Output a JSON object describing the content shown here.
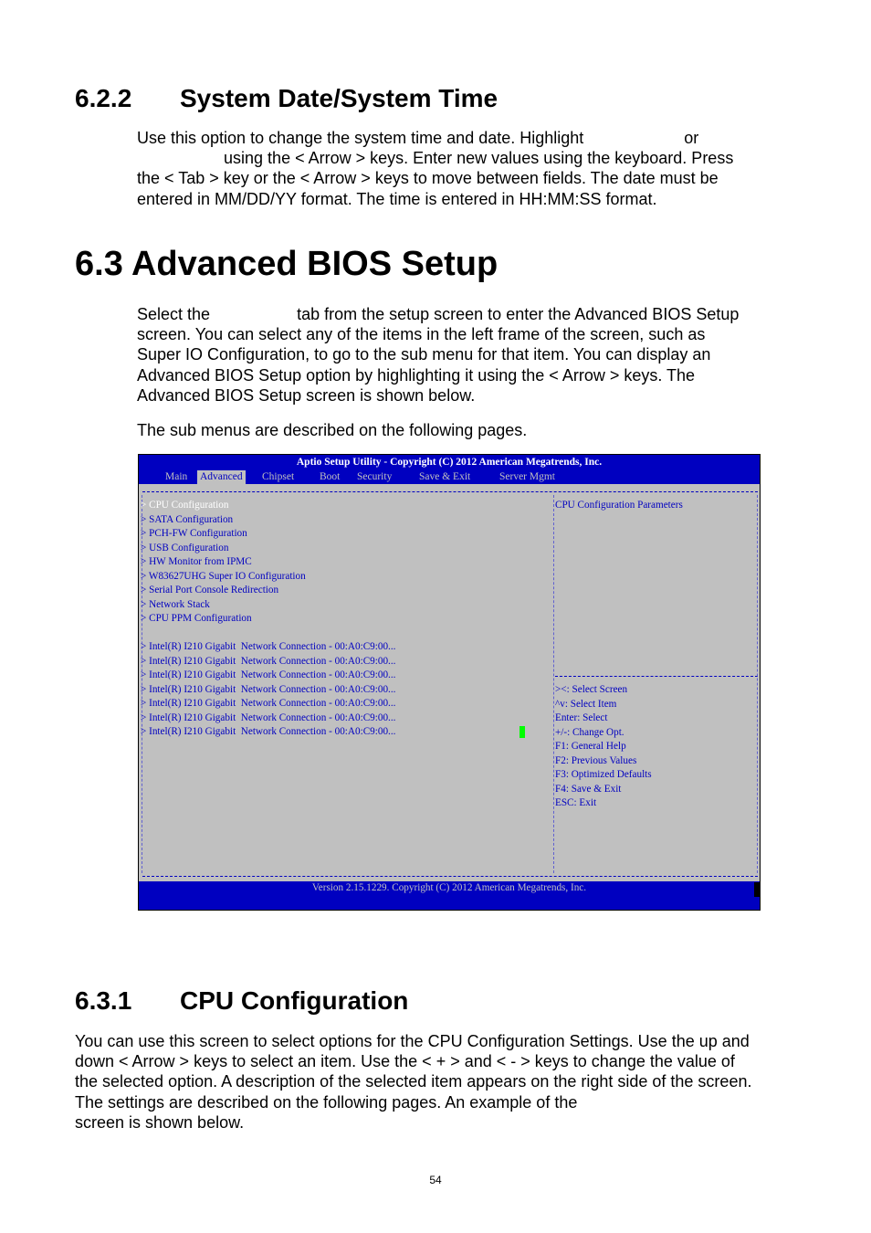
{
  "section_622": {
    "number": "6.2.2",
    "title": "System Date/System Time",
    "lines": [
      "Use this option to change the system time and date. Highlight                      or",
      "                   using the < Arrow > keys. Enter new values using the keyboard. Press",
      "the < Tab > key or the < Arrow > keys to move between fields. The date must be",
      "entered in MM/DD/YY format. The time is entered in HH:MM:SS format."
    ]
  },
  "section_63": {
    "number": "6.3",
    "title": "Advanced BIOS Setup",
    "lines": [
      "Select the                   tab from the setup screen to enter the Advanced BIOS Setup",
      "screen. You can select any of the items in the left frame of the screen, such as",
      "Super IO Configuration, to go to the sub menu for that item. You can display an",
      "Advanced BIOS Setup option by highlighting it using the < Arrow > keys. The",
      "Advanced BIOS Setup screen is shown below."
    ],
    "note": "The sub menus are described on the following pages."
  },
  "bios": {
    "title": "Aptio Setup Utility - Copyright (C) 2012 American Megatrends, Inc.",
    "tabs": [
      "Main",
      "Advanced",
      "Chipset",
      "Boot",
      "Security",
      "Save & Exit",
      "Server Mgmt"
    ],
    "active_tab": "Advanced",
    "items": [
      "> CPU Configuration",
      "> SATA Configuration",
      "> PCH-FW Configuration",
      "> USB Configuration",
      "> HW Monitor from IPMC",
      "> W83627UHG Super IO Configuration",
      "> Serial Port Console Redirection",
      "> Network Stack",
      "> CPU PPM Configuration",
      "",
      "> Intel(R) I210 Gigabit  Network Connection - 00:A0:C9:00...",
      "> Intel(R) I210 Gigabit  Network Connection - 00:A0:C9:00...",
      "> Intel(R) I210 Gigabit  Network Connection - 00:A0:C9:00...",
      "> Intel(R) I210 Gigabit  Network Connection - 00:A0:C9:00...",
      "> Intel(R) I210 Gigabit  Network Connection - 00:A0:C9:00...",
      "> Intel(R) I210 Gigabit  Network Connection - 00:A0:C9:00...",
      "> Intel(R) I210 Gigabit  Network Connection - 00:A0:C9:00..."
    ],
    "selected_index": 0,
    "description": "CPU Configuration Parameters",
    "help": [
      "><: Select Screen",
      "^v: Select Item",
      "Enter: Select",
      "+/-: Change Opt.",
      "F1: General Help",
      "F2: Previous Values",
      "F3: Optimized Defaults",
      "F4: Save & Exit",
      "ESC: Exit"
    ],
    "footer": "Version 2.15.1229. Copyright (C) 2012 American Megatrends, Inc.",
    "colors": {
      "background": "#0000c0",
      "panel": "#c0c0c0",
      "text": "#0000c0",
      "selected": "#ffffff",
      "cursor": "#00ff00"
    }
  },
  "section_631": {
    "number": "6.3.1",
    "title": "CPU Configuration",
    "lines": [
      "You can use this screen to select options for the CPU Configuration Settings. Use the up and",
      "down < Arrow > keys to select an item. Use the < + > and < - > keys to change the value of",
      "the selected option. A description of the selected item appears on the right side of the screen.",
      "The settings are described on the following pages. An example of the",
      "screen is shown below."
    ]
  },
  "page_number": "54"
}
